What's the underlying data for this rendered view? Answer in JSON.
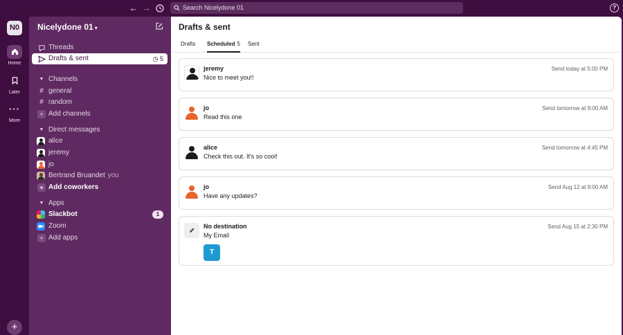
{
  "search": {
    "placeholder": "Search Nicelydone 01"
  },
  "rail": {
    "workspace_initials": "N0",
    "items": [
      {
        "label": "Home",
        "icon": "home-icon"
      },
      {
        "label": "Later",
        "icon": "bookmark-icon"
      },
      {
        "label": "More",
        "icon": "more-icon"
      }
    ]
  },
  "sidebar": {
    "workspace_name": "Nicelydone 01",
    "threads": "Threads",
    "drafts": {
      "label": "Drafts & sent",
      "count": "5"
    },
    "channels_header": "Channels",
    "channels": [
      "general",
      "random"
    ],
    "add_channels": "Add channels",
    "dm_header": "Direct messages",
    "dms": [
      {
        "name": "alice",
        "avatar_color": "#1d1c1d"
      },
      {
        "name": "jeremy",
        "avatar_color": "#1d1c1d"
      },
      {
        "name": "jo",
        "avatar_color": "#e8632b"
      },
      {
        "name": "Bertrand Bruandet",
        "avatar_color": "#5a3a20",
        "suffix": "you"
      }
    ],
    "add_coworkers": "Add coworkers",
    "apps_header": "Apps",
    "apps": [
      {
        "name": "Slackbot",
        "badge": "1",
        "color": "#36c5f0"
      },
      {
        "name": "Zoom",
        "color": "#2d8cff"
      }
    ],
    "add_apps": "Add apps"
  },
  "main": {
    "title": "Drafts & sent",
    "tabs": [
      {
        "label": "Drafts"
      },
      {
        "label": "Scheduled",
        "count": "5"
      },
      {
        "label": "Sent"
      }
    ],
    "messages": [
      {
        "name": "jeremy",
        "text": "Nice to meet you!!",
        "time": "Send today at 5:00 PM",
        "avatar_color": "#1d1c1d"
      },
      {
        "name": "jo",
        "text": "Read this one",
        "time": "Send tomorrow at 9:00 AM",
        "avatar_color": "#e8632b"
      },
      {
        "name": "alice",
        "text": "Check this out. It's so cool!",
        "time": "Send tomorrow at 4:45 PM",
        "avatar_color": "#1d1c1d"
      },
      {
        "name": "jo",
        "text": "Have any updates?",
        "time": "Send Aug 12 at 9:00 AM",
        "avatar_color": "#e8632b"
      },
      {
        "name": "No destination",
        "text": "My Email",
        "time": "Send Aug 15 at 2:30 PM",
        "attachment": "T"
      }
    ]
  }
}
